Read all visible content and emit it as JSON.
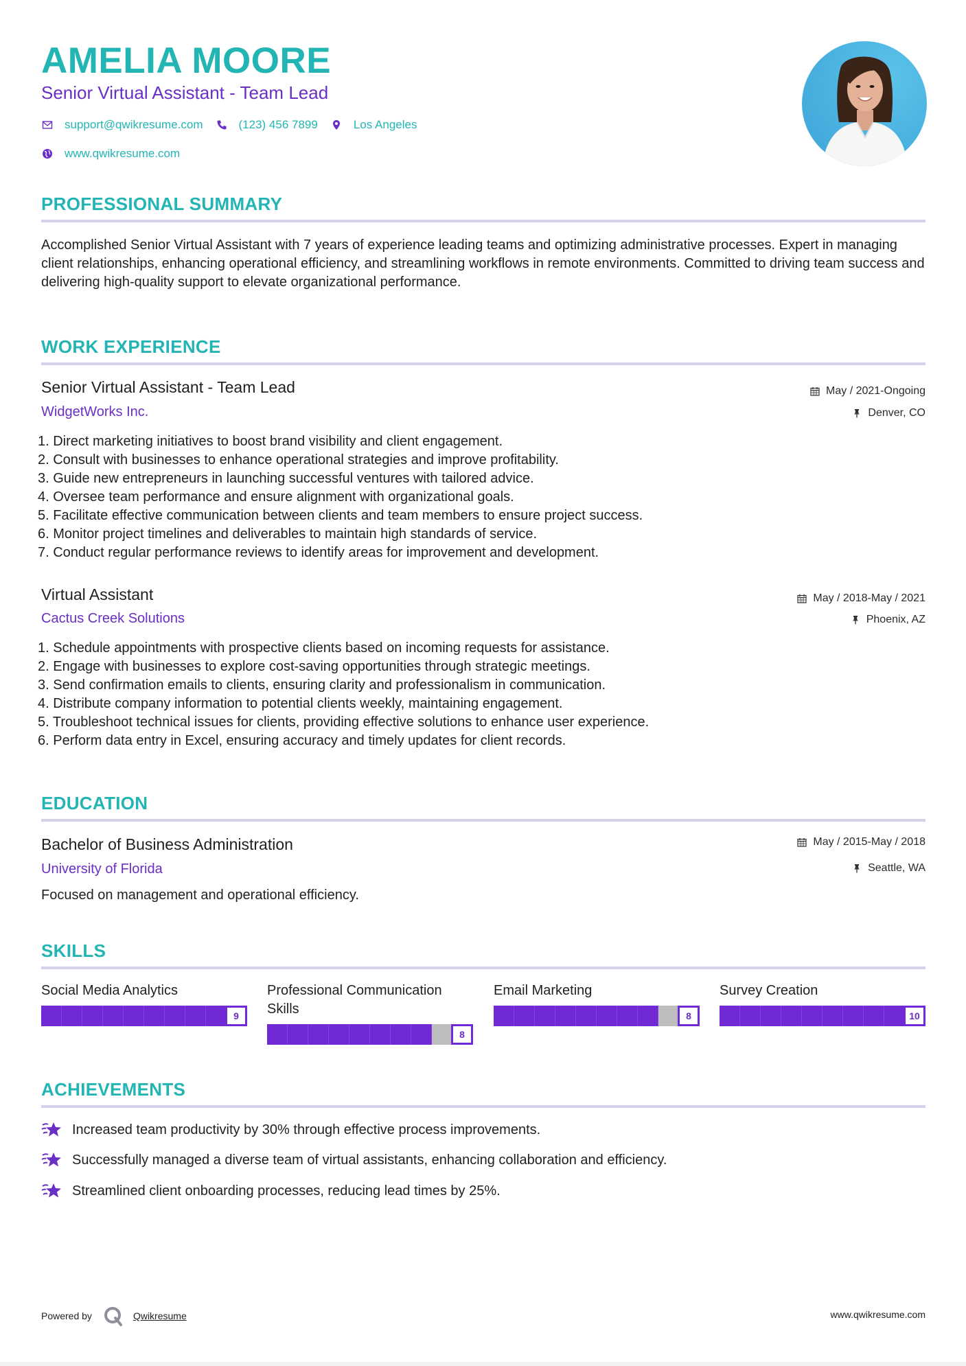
{
  "header": {
    "name": "AMELIA MOORE",
    "title": "Senior Virtual Assistant - Team Lead",
    "contacts": {
      "email": "support@qwikresume.com",
      "phone": "(123) 456 7899",
      "location": "Los Angeles",
      "website": "www.qwikresume.com"
    },
    "photo_alt": "profile-photo"
  },
  "colors": {
    "accent_teal": "#22b5b3",
    "accent_purple": "#6a2fc4",
    "rule": "#d6d2ec",
    "bar_fill": "#7029d4",
    "bar_empty": "#bdbdbd"
  },
  "summary": {
    "heading": "PROFESSIONAL SUMMARY",
    "text": "Accomplished Senior Virtual Assistant with 7 years of experience leading teams and optimizing administrative processes. Expert in managing client relationships, enhancing operational efficiency, and streamlining workflows in remote environments. Committed to driving team success and delivering high-quality support to elevate organizational performance."
  },
  "experience": {
    "heading": "WORK EXPERIENCE",
    "jobs": [
      {
        "title": "Senior Virtual Assistant - Team Lead",
        "company": "WidgetWorks Inc.",
        "dates": "May / 2021-Ongoing",
        "location": "Denver, CO",
        "bullets": [
          "1. Direct marketing initiatives to boost brand visibility and client engagement.",
          "2. Consult with businesses to enhance operational strategies and improve profitability.",
          "3. Guide new entrepreneurs in launching successful ventures with tailored advice.",
          "4. Oversee team performance and ensure alignment with organizational goals.",
          "5. Facilitate effective communication between clients and team members to ensure project success.",
          "6. Monitor project timelines and deliverables to maintain high standards of service.",
          "7. Conduct regular performance reviews to identify areas for improvement and development."
        ]
      },
      {
        "title": "Virtual Assistant",
        "company": "Cactus Creek Solutions",
        "dates": "May / 2018-May / 2021",
        "location": "Phoenix, AZ",
        "bullets": [
          "1. Schedule appointments with prospective clients based on incoming requests for assistance.",
          "2. Engage with businesses to explore cost-saving opportunities through strategic meetings.",
          "3. Send confirmation emails to clients, ensuring clarity and professionalism in communication.",
          "4. Distribute company information to potential clients weekly, maintaining engagement.",
          "5. Troubleshoot technical issues for clients, providing effective solutions to enhance user experience.",
          "6. Perform data entry in Excel, ensuring accuracy and timely updates for client records."
        ]
      }
    ]
  },
  "education": {
    "heading": "EDUCATION",
    "degree": "Bachelor of Business Administration",
    "school": "University of Florida",
    "dates": "May / 2015-May / 2018",
    "location": "Seattle, WA",
    "description": "Focused on management and operational efficiency."
  },
  "skills": {
    "heading": "SKILLS",
    "max": 10,
    "items": [
      {
        "name": "Social Media Analytics",
        "level": 9,
        "level_label": "9"
      },
      {
        "name": "Professional Communication Skills",
        "level": 8,
        "level_label": "8"
      },
      {
        "name": "Email Marketing",
        "level": 8,
        "level_label": "8"
      },
      {
        "name": "Survey Creation",
        "level": 10,
        "level_label": "10"
      }
    ]
  },
  "achievements": {
    "heading": "ACHIEVEMENTS",
    "items": [
      "Increased team productivity by 30% through effective process improvements.",
      "Successfully managed a diverse team of virtual assistants, enhancing collaboration and efficiency.",
      "Streamlined client onboarding processes, reducing lead times by 25%."
    ]
  },
  "footer": {
    "powered_by": "Powered by",
    "brand": "Qwikresume",
    "website": "www.qwikresume.com"
  }
}
